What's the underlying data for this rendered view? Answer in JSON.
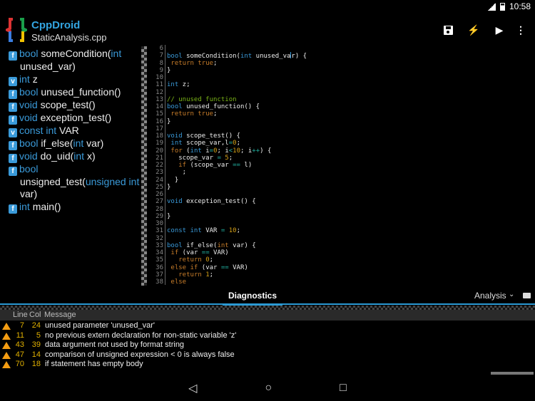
{
  "status": {
    "time": "10:58",
    "network": "3G"
  },
  "app": {
    "title": "CppDroid",
    "file": "StaticAnalysis.cpp"
  },
  "toolbar": {
    "save": "save",
    "build": "build",
    "run": "run",
    "more": "more"
  },
  "outline": [
    {
      "badge": "f",
      "type": "bool",
      "name": "someCondition(",
      "ptype": "int",
      "rest": " unused_var)"
    },
    {
      "badge": "v",
      "type": "int",
      "name": "z",
      "ptype": "",
      "rest": ""
    },
    {
      "badge": "f",
      "type": "bool",
      "name": "unused_function()",
      "ptype": "",
      "rest": ""
    },
    {
      "badge": "f",
      "type": "void",
      "name": "scope_test()",
      "ptype": "",
      "rest": ""
    },
    {
      "badge": "f",
      "type": "void",
      "name": "exception_test()",
      "ptype": "",
      "rest": ""
    },
    {
      "badge": "v",
      "type": "const int",
      "name": "VAR",
      "ptype": "",
      "rest": ""
    },
    {
      "badge": "f",
      "type": "bool",
      "name": "if_else(",
      "ptype": "int",
      "rest": " var)"
    },
    {
      "badge": "f",
      "type": "void",
      "name": "do_uid(",
      "ptype": "int",
      "rest": " x)"
    },
    {
      "badge": "f",
      "type": "bool",
      "name": "unsigned_test(",
      "ptype": "unsigned int",
      "rest": " var)"
    },
    {
      "badge": "f",
      "type": "int",
      "name": "main()",
      "ptype": "",
      "rest": ""
    }
  ],
  "code": [
    {
      "n": "6",
      "t": []
    },
    {
      "n": "7",
      "t": [
        [
          "bool",
          "kw"
        ],
        [
          " someCondition(",
          ""
        ],
        [
          "int",
          "kw"
        ],
        [
          " unused_va",
          ""
        ],
        [
          "|",
          "cursor"
        ],
        [
          "r) {",
          ""
        ]
      ]
    },
    {
      "n": "8",
      "t": [
        [
          " ",
          ""
        ],
        [
          "return",
          "ctl"
        ],
        [
          " ",
          ""
        ],
        [
          "true",
          "ctl"
        ],
        [
          ";",
          ""
        ]
      ]
    },
    {
      "n": "9",
      "t": [
        [
          "}",
          ""
        ]
      ]
    },
    {
      "n": "10",
      "t": []
    },
    {
      "n": "11",
      "t": [
        [
          "int",
          "kw"
        ],
        [
          " z;",
          ""
        ]
      ]
    },
    {
      "n": "12",
      "t": []
    },
    {
      "n": "13",
      "t": [
        [
          "// unused function",
          "cm"
        ]
      ]
    },
    {
      "n": "14",
      "t": [
        [
          "bool",
          "kw"
        ],
        [
          " unused_function() {",
          ""
        ]
      ]
    },
    {
      "n": "15",
      "t": [
        [
          " ",
          ""
        ],
        [
          "return",
          "ctl"
        ],
        [
          " ",
          ""
        ],
        [
          "true",
          "ctl"
        ],
        [
          ";",
          ""
        ]
      ]
    },
    {
      "n": "16",
      "t": [
        [
          "}",
          ""
        ]
      ]
    },
    {
      "n": "17",
      "t": []
    },
    {
      "n": "18",
      "t": [
        [
          "void",
          "kw"
        ],
        [
          " scope_test() {",
          ""
        ]
      ]
    },
    {
      "n": "19",
      "t": [
        [
          " ",
          ""
        ],
        [
          "int",
          "kw"
        ],
        [
          " scope_var,l",
          ""
        ],
        [
          "=",
          "op"
        ],
        [
          "0",
          "num"
        ],
        [
          ";",
          ""
        ]
      ]
    },
    {
      "n": "20",
      "t": [
        [
          " ",
          ""
        ],
        [
          "for",
          "ctl"
        ],
        [
          " (",
          ""
        ],
        [
          "int",
          "kw"
        ],
        [
          " i",
          ""
        ],
        [
          "=",
          "op"
        ],
        [
          "0",
          "num"
        ],
        [
          "; i",
          ""
        ],
        [
          "<",
          "op"
        ],
        [
          "10",
          "num"
        ],
        [
          "; i",
          ""
        ],
        [
          "++",
          "op"
        ],
        [
          ") {",
          ""
        ]
      ]
    },
    {
      "n": "21",
      "t": [
        [
          "   scope_var ",
          ""
        ],
        [
          "=",
          "op"
        ],
        [
          " ",
          ""
        ],
        [
          "5",
          "num"
        ],
        [
          ";",
          ""
        ]
      ]
    },
    {
      "n": "22",
      "t": [
        [
          "   ",
          ""
        ],
        [
          "if",
          "ctl"
        ],
        [
          " (scope_var ",
          ""
        ],
        [
          "==",
          "op"
        ],
        [
          " l)",
          ""
        ]
      ]
    },
    {
      "n": "23",
      "t": [
        [
          "    ;",
          ""
        ]
      ]
    },
    {
      "n": "24",
      "t": [
        [
          "  }",
          ""
        ]
      ]
    },
    {
      "n": "25",
      "t": [
        [
          "}",
          ""
        ]
      ]
    },
    {
      "n": "26",
      "t": []
    },
    {
      "n": "27",
      "t": [
        [
          "void",
          "kw"
        ],
        [
          " exception_test() {",
          ""
        ]
      ]
    },
    {
      "n": "28",
      "t": []
    },
    {
      "n": "29",
      "t": [
        [
          "}",
          ""
        ]
      ]
    },
    {
      "n": "30",
      "t": []
    },
    {
      "n": "31",
      "t": [
        [
          "const",
          "kw"
        ],
        [
          " ",
          ""
        ],
        [
          "int",
          "kw"
        ],
        [
          " VAR ",
          ""
        ],
        [
          "=",
          "op"
        ],
        [
          " ",
          ""
        ],
        [
          "10",
          "num"
        ],
        [
          ";",
          ""
        ]
      ]
    },
    {
      "n": "32",
      "t": []
    },
    {
      "n": "33",
      "t": [
        [
          "bool",
          "kw"
        ],
        [
          " if_else(",
          ""
        ],
        [
          "int",
          "ctl"
        ],
        [
          " var) {",
          ""
        ]
      ]
    },
    {
      "n": "34",
      "t": [
        [
          " ",
          ""
        ],
        [
          "if",
          "ctl"
        ],
        [
          " (var ",
          ""
        ],
        [
          "==",
          "op"
        ],
        [
          " VAR)",
          ""
        ]
      ]
    },
    {
      "n": "35",
      "t": [
        [
          "   ",
          ""
        ],
        [
          "return",
          "ctl"
        ],
        [
          " ",
          ""
        ],
        [
          "0",
          "num"
        ],
        [
          ";",
          ""
        ]
      ]
    },
    {
      "n": "36",
      "t": [
        [
          " ",
          ""
        ],
        [
          "else if",
          "ctl"
        ],
        [
          " (var ",
          ""
        ],
        [
          "==",
          "op"
        ],
        [
          " VAR)",
          ""
        ]
      ]
    },
    {
      "n": "37",
      "t": [
        [
          "   ",
          ""
        ],
        [
          "return",
          "ctl"
        ],
        [
          " ",
          ""
        ],
        [
          "1",
          "num"
        ],
        [
          ";",
          ""
        ]
      ]
    },
    {
      "n": "38",
      "t": [
        [
          " ",
          ""
        ],
        [
          "else",
          "ctl"
        ]
      ]
    }
  ],
  "panel": {
    "tab_diagnostics": "Diagnostics",
    "tab_analysis": "Analysis",
    "headers": {
      "line": "Line",
      "col": "Col",
      "message": "Message"
    },
    "rows": [
      {
        "line": "7",
        "col": "24",
        "message": "unused parameter 'unused_var'"
      },
      {
        "line": "11",
        "col": "5",
        "message": "no previous extern declaration for non-static variable 'z'"
      },
      {
        "line": "43",
        "col": "39",
        "message": "data argument not used by format string"
      },
      {
        "line": "47",
        "col": "14",
        "message": "comparison of unsigned expression < 0 is always false"
      },
      {
        "line": "70",
        "col": "18",
        "message": "if statement has empty body"
      }
    ]
  },
  "colors": {
    "accent": "#2b9ad4",
    "keyword": "#3a9ad9",
    "control": "#c87d2a",
    "number": "#d4a017",
    "warning": "#f39c12"
  }
}
